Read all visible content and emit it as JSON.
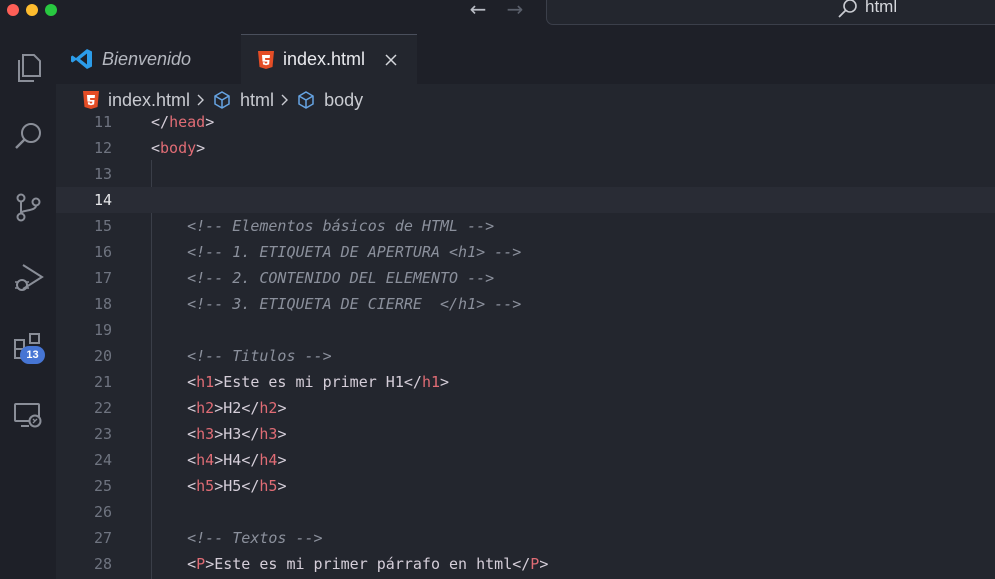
{
  "titlebar": {
    "command_center_text": "html"
  },
  "activity_bar": {
    "extensions_badge": "13"
  },
  "tabs": [
    {
      "label": "Bienvenido"
    },
    {
      "label": "index.html"
    }
  ],
  "breadcrumb": [
    "index.html",
    "html",
    "body"
  ],
  "editor": {
    "lines": [
      {
        "n": "11",
        "code": "</head>"
      },
      {
        "n": "12",
        "code": "<body>"
      },
      {
        "n": "13",
        "code": ""
      },
      {
        "n": "14",
        "code": ""
      },
      {
        "n": "15",
        "code": "<!-- Elementos básicos de HTML -->"
      },
      {
        "n": "16",
        "code": "<!-- 1. ETIQUETA DE APERTURA <h1> -->"
      },
      {
        "n": "17",
        "code": "<!-- 2. CONTENIDO DEL ELEMENTO -->"
      },
      {
        "n": "18",
        "code": "<!-- 3. ETIQUETA DE CIERRE  </h1> -->"
      },
      {
        "n": "19",
        "code": ""
      },
      {
        "n": "20",
        "code": "<!-- Titulos -->"
      },
      {
        "n": "21",
        "code": "<h1>Este es mi primer H1</h1>"
      },
      {
        "n": "22",
        "code": "<h2>H2</h2>"
      },
      {
        "n": "23",
        "code": "<h3>H3</h3>"
      },
      {
        "n": "24",
        "code": "<h4>H4</h4>"
      },
      {
        "n": "25",
        "code": "<h5>H5</h5>"
      },
      {
        "n": "26",
        "code": ""
      },
      {
        "n": "27",
        "code": "<!-- Textos -->"
      },
      {
        "n": "28",
        "code": "<P>Este es mi primer párrafo en html</P>"
      }
    ]
  },
  "colors": {
    "tag": "#e06c75",
    "comment": "#8b909c",
    "text": "#d5ced9",
    "badge": "#4675d4",
    "html5_icon": "#e44d26",
    "vscode_icon": "#2c9ce9"
  }
}
